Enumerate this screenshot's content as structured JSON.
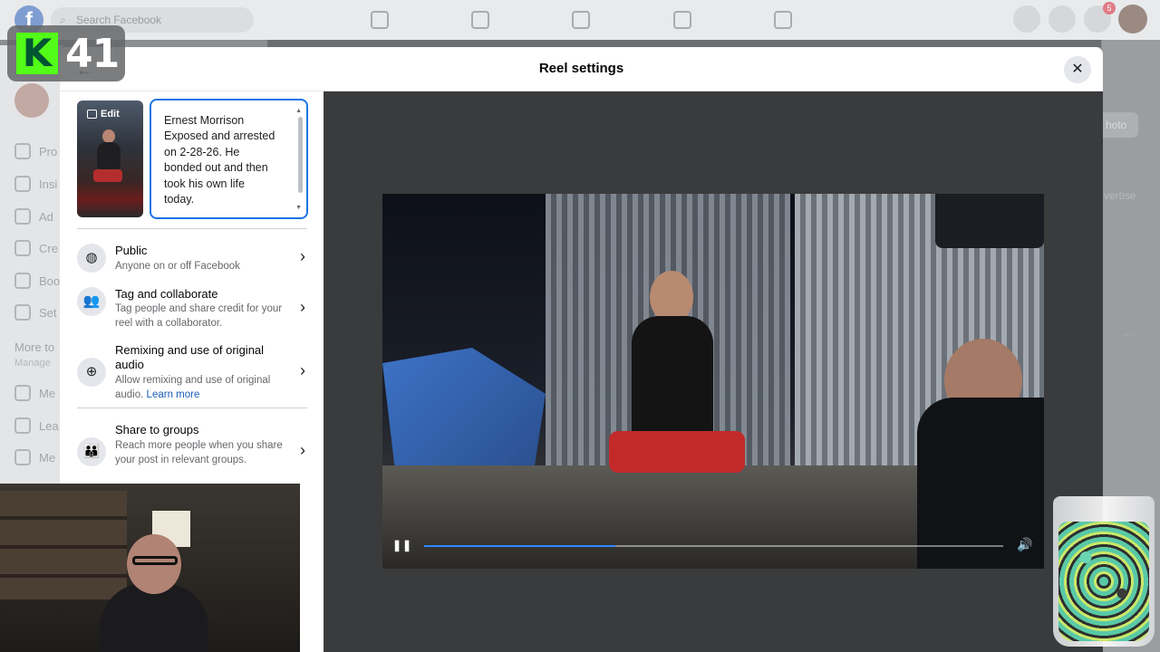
{
  "topbar": {
    "logo_text": "f",
    "search_placeholder": "Search Facebook",
    "notification_count": "5"
  },
  "left_sidebar": {
    "items": [
      {
        "label": "Pro",
        "icon": "profile-icon"
      },
      {
        "label": "Insi",
        "icon": "insights-icon"
      },
      {
        "label": "Ad",
        "icon": "ad-center-icon"
      },
      {
        "label": "Cre",
        "icon": "creator-icon"
      },
      {
        "label": "Boo",
        "icon": "instagram-icon"
      },
      {
        "label": "Set",
        "icon": "settings-icon"
      }
    ],
    "section_title": "More to",
    "section_sub": "Manage",
    "more_items": [
      {
        "label": "Me",
        "icon": "check-icon"
      },
      {
        "label": "Lea",
        "icon": "learn-icon"
      },
      {
        "label": "Me",
        "icon": "meta-icon"
      }
    ]
  },
  "right_column": {
    "photo_label": "hoto",
    "advertise_label": "vertise",
    "dots": "···"
  },
  "kick": {
    "logo_letter": "K",
    "viewer_count": "41",
    "color": "#53fc18"
  },
  "modal": {
    "title": "Reel settings",
    "back_label": "←",
    "close_label": "✕",
    "thumbnail_edit_label": "Edit",
    "caption_lines": [
      "Ernest Morrison",
      "Exposed and arrested",
      "on 2-28-26. He",
      "bonded out and then",
      "took his own life",
      "today."
    ],
    "options": [
      {
        "title": "Public",
        "desc": "Anyone on or off Facebook",
        "icon": "globe-icon"
      },
      {
        "title": "Tag and collaborate",
        "desc": "Tag people and share credit for your reel with a collaborator.",
        "icon": "people-icon"
      },
      {
        "title": "Remixing and use of original audio",
        "desc": "Allow remixing and use of original audio.",
        "link": "Learn more",
        "icon": "remix-icon"
      },
      {
        "title": "Share to groups",
        "desc": "Reach more people when you share your post in relevant groups.",
        "icon": "groups-icon"
      }
    ],
    "video": {
      "progress_fraction": 0.33,
      "accent": "#2d88ff"
    }
  }
}
